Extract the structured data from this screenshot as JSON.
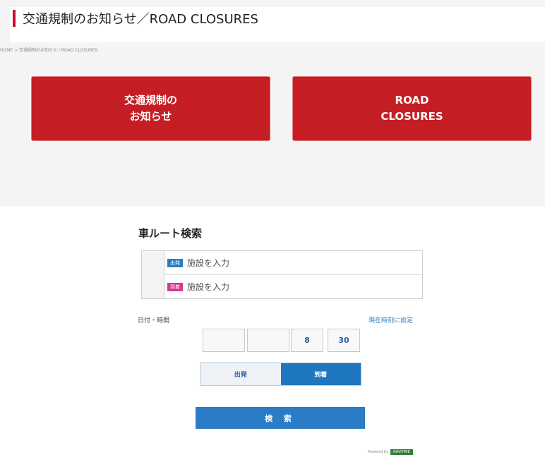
{
  "road_closures": {
    "title": "交通規制のお知らせ／ROAD CLOSURES",
    "breadcrumb": "HOME > 交通規制のお知らせ / ROAD CLOSURES",
    "jp_button": {
      "line1": "交通規制の",
      "line2": "お知らせ"
    },
    "en_button": {
      "line1": "ROAD",
      "line2": "CLOSURES"
    },
    "accent_color": "#c41e24"
  },
  "route_search": {
    "title": "車ルート検索",
    "from": {
      "tag": "出発",
      "placeholder": "施設を入力"
    },
    "to": {
      "tag": "到着",
      "placeholder": "施設を入力"
    },
    "datetime_label": "日付・時間",
    "set_now_link": "現在時刻に設定",
    "date_year": "",
    "date_month_day": "",
    "hour": "8",
    "minute": "30",
    "toggle": {
      "depart": "出発",
      "arrive": "到着",
      "selected": "arrive"
    },
    "search_button": "検 索",
    "powered_by": "Powered by",
    "logo_text": "NAVITIME",
    "primary_color": "#2a7cc7"
  }
}
